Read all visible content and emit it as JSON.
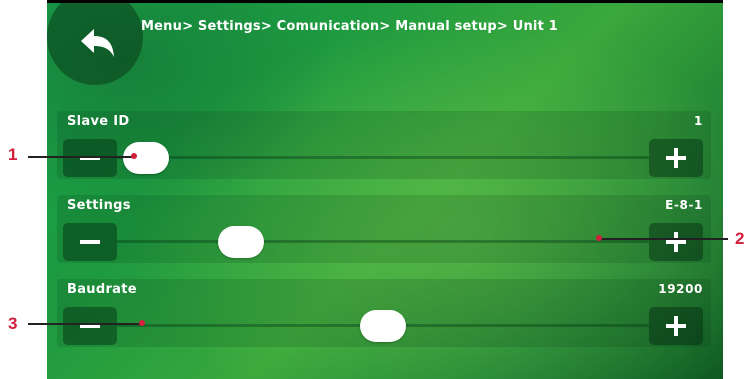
{
  "breadcrumb": "Menu> Settings> Comunication> Manual setup> Unit 1",
  "rows": [
    {
      "label": "Slave ID",
      "value": "1",
      "slider_fraction": 0.0
    },
    {
      "label": "Settings",
      "value": "E-8-1",
      "slider_fraction": 0.2
    },
    {
      "label": "Baudrate",
      "value": "19200",
      "slider_fraction": 0.5
    }
  ],
  "callouts": [
    "1",
    "2",
    "3"
  ],
  "icons": {
    "back": "back-arrow-icon",
    "minus": "minus-icon",
    "plus": "plus-icon"
  },
  "colors": {
    "callout": "#d21f3c",
    "screen_green": "#1e9a40"
  }
}
